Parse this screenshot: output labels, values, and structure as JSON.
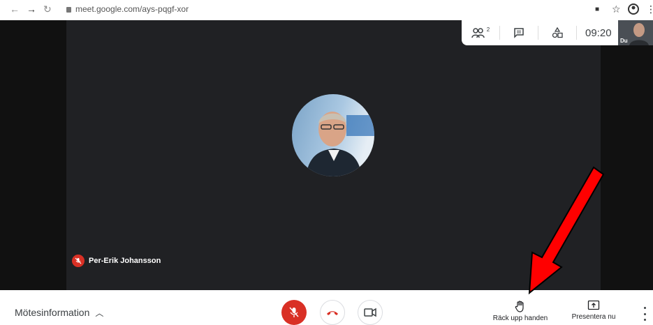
{
  "browser": {
    "url": "meet.google.com/ays-pqgf-xor",
    "icons": [
      "back-icon",
      "forward-icon",
      "reload-icon",
      "lock-icon",
      "camera-indicator-icon",
      "star-icon",
      "profile-icon",
      "menu-icon"
    ]
  },
  "top_panel": {
    "people_count": "2",
    "time": "09:20",
    "self_view_label": "Du"
  },
  "participant": {
    "name": "Per-Erik Johansson",
    "muted": true
  },
  "bottom_bar": {
    "meeting_info_label": "Mötesinformation",
    "raise_hand_label": "Räck upp handen",
    "present_label": "Presentera nu"
  },
  "colors": {
    "stage_bg": "#202124",
    "mute_red": "#d93025",
    "annotation_red": "#ff0000"
  }
}
